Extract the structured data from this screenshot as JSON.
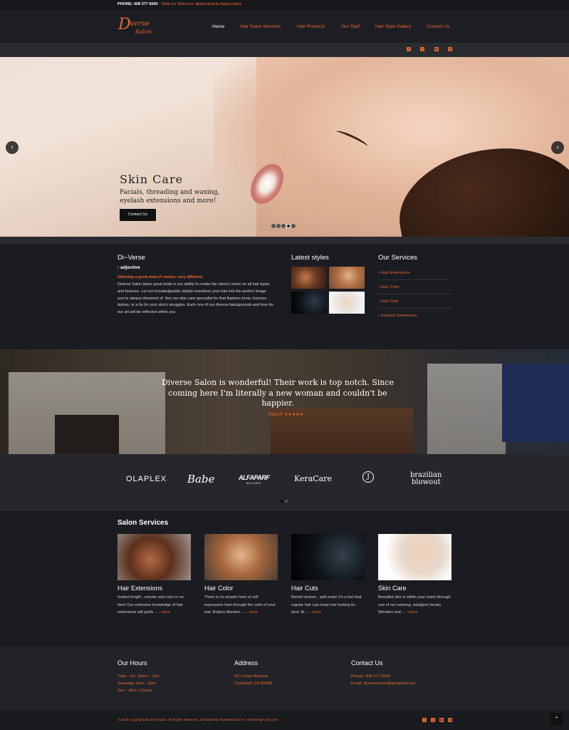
{
  "colors": {
    "accent": "#e8662e",
    "bg": "#1b1c21",
    "bar": "#2a2b30"
  },
  "topbar": {
    "phone": "PHONE: 408 377 6000",
    "walkin": " - Walk Ins Welcome. Appointments Appreciated."
  },
  "logo": {
    "d": "D",
    "line1": "iverse",
    "line2": "Salon"
  },
  "nav": [
    "Home",
    "Hair Salon Services",
    "Hair Products",
    "Our Staff",
    "Hair Style Gallery",
    "Contact Us"
  ],
  "social": [
    "facebook-icon",
    "yelp-icon",
    "youtube-icon",
    "instagram-icon"
  ],
  "hero": {
    "title": "Skin Care",
    "text": "Facials, threading and waxing, eyelash extensions and more!",
    "button": "Contact Us",
    "prev": "‹",
    "next": "›",
    "slide_count": 5,
    "active_slide": 4
  },
  "about": {
    "title": "Di~Verse",
    "adjective": "- adjective",
    "definition": "Showing a great deal of variety; very different.",
    "description": "Diverse Salon takes great pride in our ability to create the client's vision on all hair types and textures. Let our knowledgeable stylists transform your hair into the perfect image you've always dreamed of. See our skin care specialist for that flawless brow, luscious lashes, or a fix for your skin's struggles. Each one of our diverse backgrounds and love for our art will be reflected within you."
  },
  "latest": {
    "title": "Latest styles"
  },
  "our_services": {
    "title": "Our Services",
    "items": [
      "Hair Extensions",
      "Hair Color",
      "Hair Cuts",
      "Eyelash Extensions"
    ]
  },
  "testimonial": {
    "quote": "Diverse Salon is wonderful! Their work is top notch. Since coming here I'm literally a new woman and couldn't be happier.",
    "author": "- Patty P.",
    "stars": "★★★★★"
  },
  "brands": [
    "OLAPLEX",
    "Babe",
    "ALFAPARF",
    "MILANO",
    "KeraCare",
    "J",
    "brazilian",
    "blowout"
  ],
  "salon_services": {
    "title": "Salon Services",
    "more": "more",
    "cards": [
      {
        "title": "Hair Extensions",
        "text": "Instant length , volume and color in no time! Our extensive knowledge of hair extensions will guide ..."
      },
      {
        "title": "Hair Color",
        "text": "There is no simpler form of self expression than through the color of your hair. Buttery blondes, ..."
      },
      {
        "title": "Hair Cuts",
        "text": "Banish broken , split ends! It's a fact that regular hair cuts keep hair looking its best. At ..."
      },
      {
        "title": "Skin Care",
        "text": "Beautiful skin is within your reach through one of our relaxing, indulgent facials. Wrinkles and ..."
      }
    ]
  },
  "footer": {
    "hours_title": "Our Hours",
    "hours": [
      "Tues - Fri: 10am - 7pm",
      "Saturday: 8am - 5pm",
      "Sun - Mon: Closed"
    ],
    "address_title": "Address",
    "address": [
      "821 Union Avenue",
      "Campbell, CA 95008"
    ],
    "contact_title": "Contact Us",
    "contact": [
      "Phone: 408 377 6000",
      "Email: diversesalon@sbcglobal.net"
    ],
    "copyright": "© 2015 Copyright Diverse Salon. All Rights Reserved. Designed by Pixelwebsource - web design san jose"
  }
}
